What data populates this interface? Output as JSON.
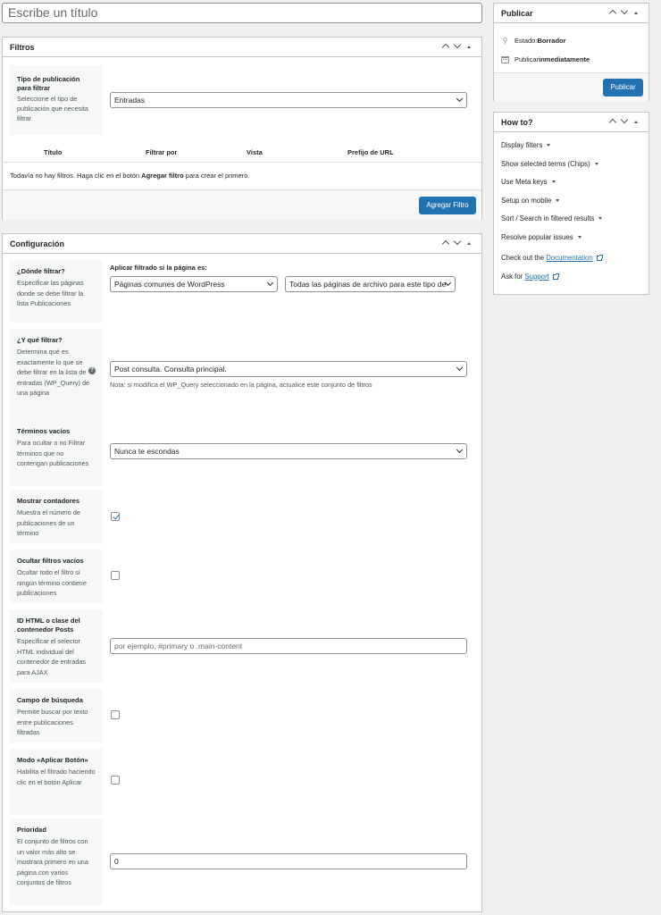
{
  "title_placeholder": "Escribe un título",
  "filtros": {
    "title": "Filtros",
    "post_type_label": "Tipo de publicación para filtrar",
    "post_type_desc": "Seleccione el tipo de publicación que necesita filtrar",
    "post_type_value": "Entradas",
    "columns": [
      "Título",
      "Filtrar por",
      "Vista",
      "Prefijo de URL"
    ],
    "empty_prefix": "Todavía no hay filtros. Haga clic en el botón ",
    "empty_bold": "Agregar filtro",
    "empty_suffix": " para crear el primero.",
    "add_button": "Agregar Filtro"
  },
  "config": {
    "title": "Configuración",
    "where": {
      "label": "¿Dónde filtrar?",
      "desc": "Especificar las páginas donde se debe filtrar la lista Publicaciones",
      "apply_label": "Aplicar filtrado si la página es:",
      "select1": "Páginas comunes de WordPress",
      "select2": "Todas las páginas de archivo para este tipo de"
    },
    "what": {
      "label": "¿Y qué filtrar?",
      "desc": "Determina qué es exactamente lo que se debe filtrar en la lista de entradas (WP_Query) de una página",
      "value": "Post consulta. Consulta principal.",
      "note": "Nota: si modifica el WP_Query seleccionado en la página, actualice este conjunto de filtros"
    },
    "empty_terms": {
      "label": "Términos vacíos",
      "desc": "Para ocultar o no Filtrar términos que no contengan publicaciones",
      "value": "Nunca te escondas"
    },
    "counters": {
      "label": "Mostrar contadores",
      "desc": "Muestra el número de publicaciones de un término",
      "checked": true
    },
    "hide_empty": {
      "label": "Ocultar filtros vacíos",
      "desc": "Ocultar todo el filtro si ningún término contiene publicaciones",
      "checked": false
    },
    "container": {
      "label": "ID HTML o clase del contenedor Posts",
      "desc": "Especificar el selector HTML individual del contenedor de entradas para AJAX",
      "placeholder": "por ejemplo, #primary o .main-content"
    },
    "search": {
      "label": "Campo de búsqueda",
      "desc": "Permite buscar por texto entre publicaciones filtradas",
      "checked": false
    },
    "apply_button": {
      "label": "Modo «Aplicar Botón»",
      "desc": "Habilita el filtrado haciendo clic en el botón Aplicar",
      "checked": false
    },
    "priority": {
      "label": "Prioridad",
      "desc": "El conjunto de filtros con un valor más alto se mostrará primero en una página con varios conjuntos de filtros",
      "value": "0"
    }
  },
  "publicar": {
    "title": "Publicar",
    "status_prefix": "Estado: ",
    "status_value": "Borrador",
    "publish_prefix": "Publicar ",
    "publish_value": "inmediatamente",
    "button": "Publicar"
  },
  "howto": {
    "title": "How to?",
    "items": [
      "Display filters",
      "Show selected terms (Chips)",
      "Use Meta keys",
      "Setup on mobile",
      "Sort / Search in filtered results",
      "Resolve popular issues"
    ],
    "doc_prefix": "Check out the ",
    "doc_link": "Documentation",
    "support_prefix": "Ask for ",
    "support_link": "Support"
  },
  "colors": {
    "primary": "#2271b1",
    "border": "#c3c4c7",
    "label_bg": "#f6f7f7",
    "page_bg": "#f0f0f1"
  }
}
